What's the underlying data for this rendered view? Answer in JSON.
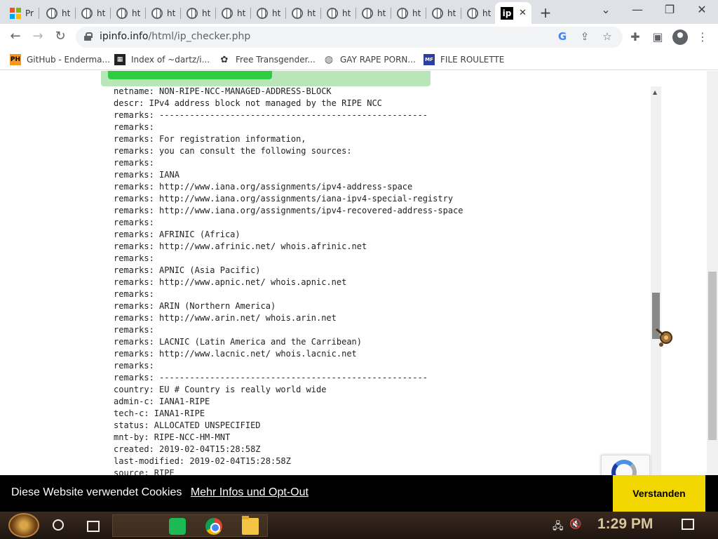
{
  "tabs": [
    {
      "title": "Pr",
      "icon": "microsoft-icon"
    },
    {
      "title": "ht",
      "icon": "globe-icon"
    },
    {
      "title": "ht",
      "icon": "globe-icon"
    },
    {
      "title": "ht",
      "icon": "globe-icon"
    },
    {
      "title": "ht",
      "icon": "globe-icon"
    },
    {
      "title": "ht",
      "icon": "globe-icon"
    },
    {
      "title": "ht",
      "icon": "globe-icon"
    },
    {
      "title": "ht",
      "icon": "globe-icon"
    },
    {
      "title": "ht",
      "icon": "globe-icon"
    },
    {
      "title": "ht",
      "icon": "globe-icon"
    },
    {
      "title": "ht",
      "icon": "globe-icon"
    },
    {
      "title": "ht",
      "icon": "globe-icon"
    },
    {
      "title": "ht",
      "icon": "globe-icon"
    },
    {
      "title": "ht",
      "icon": "globe-icon"
    }
  ],
  "active_tab": {
    "favicon_text": "ip",
    "close": "✕"
  },
  "toolbar": {
    "back": "←",
    "forward": "→",
    "reload": "↻",
    "url_host": "ipinfo.info",
    "url_path": "/html/ip_checker.php",
    "google": "G",
    "share": "⇪",
    "star": "☆",
    "extensions": "✚",
    "sidebar": "▣",
    "menu": "⋮"
  },
  "window_controls": {
    "tabsearch": "⌄",
    "minimize": "—",
    "restore": "❐",
    "close": "✕"
  },
  "bookmarks": [
    {
      "icon_text": "PH",
      "label": "GitHub - Enderma..."
    },
    {
      "icon_text": "▦",
      "label": "Index of ~dartz/i..."
    },
    {
      "icon_text": "✿",
      "label": "Free Transgender..."
    },
    {
      "icon_text": "◍",
      "label": "GAY RAPE PORN..."
    },
    {
      "icon_text": "MF",
      "label": "FILE ROULETTE"
    }
  ],
  "whois_lines": [
    "netname: NON-RIPE-NCC-MANAGED-ADDRESS-BLOCK",
    "descr: IPv4 address block not managed by the RIPE NCC",
    "remarks: -----------------------------------------------------",
    "remarks:",
    "remarks: For registration information,",
    "remarks: you can consult the following sources:",
    "remarks:",
    "remarks: IANA",
    "remarks: http://www.iana.org/assignments/ipv4-address-space",
    "remarks: http://www.iana.org/assignments/iana-ipv4-special-registry",
    "remarks: http://www.iana.org/assignments/ipv4-recovered-address-space",
    "remarks:",
    "remarks: AFRINIC (Africa)",
    "remarks: http://www.afrinic.net/ whois.afrinic.net",
    "remarks:",
    "remarks: APNIC (Asia Pacific)",
    "remarks: http://www.apnic.net/ whois.apnic.net",
    "remarks:",
    "remarks: ARIN (Northern America)",
    "remarks: http://www.arin.net/ whois.arin.net",
    "remarks:",
    "remarks: LACNIC (Latin America and the Carribean)",
    "remarks: http://www.lacnic.net/ whois.lacnic.net",
    "remarks:",
    "remarks: -----------------------------------------------------",
    "country: EU # Country is really world wide",
    "admin-c: IANA1-RIPE",
    "tech-c: IANA1-RIPE",
    "status: ALLOCATED UNSPECIFIED",
    "mnt-by: RIPE-NCC-HM-MNT",
    "created: 2019-02-04T15:28:58Z",
    "last-modified: 2019-02-04T15:28:58Z",
    "source: RIPE"
  ],
  "cookie": {
    "text": "Diese Website verwendet Cookies",
    "link": "Mehr Infos und Opt-Out",
    "button": "Verstanden"
  },
  "taskbar": {
    "clock": "1:29 PM",
    "tray_network": "🖧",
    "tray_volume": "🔇"
  },
  "colors": {
    "cookie_button": "#f1d600",
    "green_bar": "#2ecc40"
  }
}
